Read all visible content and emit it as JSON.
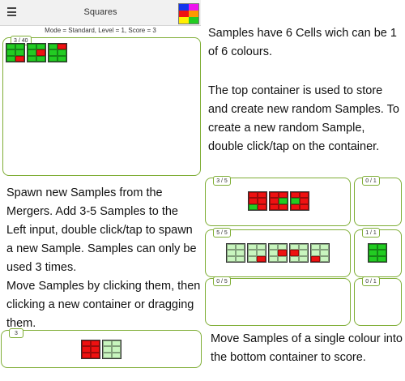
{
  "header": {
    "title": "Squares",
    "menu_icon": "hamburger-menu-icon"
  },
  "status_text": "Mode = Standard, Level = 1, Score = 3",
  "colors": {
    "green": "#22cc22",
    "light": "#c8f5be",
    "red": "#ee1111",
    "yellow": "#ffee00",
    "blue": "#1133ee",
    "magenta": "#ee11ee",
    "border": "#7fae36"
  },
  "logo_cells": [
    "#1133ee",
    "#ee11ee",
    "#ee1111",
    "#ff9900",
    "#ffee00",
    "#22cc22"
  ],
  "store": {
    "count": "3 / 40",
    "samples": [
      [
        "#22cc22",
        "#22cc22",
        "#22cc22",
        "#22cc22",
        "#22cc22",
        "#ee1111"
      ],
      [
        "#22cc22",
        "#22cc22",
        "#22cc22",
        "#ee1111",
        "#22cc22",
        "#22cc22"
      ],
      [
        "#22cc22",
        "#ee1111",
        "#22cc22",
        "#22cc22",
        "#22cc22",
        "#22cc22"
      ]
    ]
  },
  "merger1": {
    "left": {
      "count": "3 / 5",
      "samples": [
        [
          "#ee1111",
          "#ee1111",
          "#ee1111",
          "#ee1111",
          "#22cc22",
          "#ee1111"
        ],
        [
          "#ee1111",
          "#ee1111",
          "#ee1111",
          "#22cc22",
          "#ee1111",
          "#ee1111"
        ],
        [
          "#ee1111",
          "#ee1111",
          "#22cc22",
          "#ee1111",
          "#ee1111",
          "#ee1111"
        ]
      ]
    },
    "right": {
      "count": "0 / 1",
      "samples": []
    }
  },
  "merger2": {
    "left": {
      "count": "5 / 5",
      "samples": [
        [
          "#c8f5be",
          "#c8f5be",
          "#c8f5be",
          "#c8f5be",
          "#c8f5be",
          "#c8f5be"
        ],
        [
          "#c8f5be",
          "#c8f5be",
          "#c8f5be",
          "#c8f5be",
          "#c8f5be",
          "#ee1111"
        ],
        [
          "#c8f5be",
          "#c8f5be",
          "#c8f5be",
          "#ee1111",
          "#c8f5be",
          "#c8f5be"
        ],
        [
          "#c8f5be",
          "#c8f5be",
          "#ee1111",
          "#c8f5be",
          "#c8f5be",
          "#c8f5be"
        ],
        [
          "#c8f5be",
          "#c8f5be",
          "#c8f5be",
          "#c8f5be",
          "#ee1111",
          "#c8f5be"
        ]
      ]
    },
    "right": {
      "count": "1 / 1",
      "samples": [
        [
          "#22cc22",
          "#22cc22",
          "#22cc22",
          "#22cc22",
          "#22cc22",
          "#22cc22"
        ]
      ]
    }
  },
  "merger3": {
    "left": {
      "count": "0 / 5",
      "samples": []
    },
    "right": {
      "count": "0 / 1",
      "samples": []
    }
  },
  "score_box": {
    "count": "3",
    "samples": [
      [
        "#ee1111",
        "#ee1111",
        "#ee1111",
        "#ee1111",
        "#ee1111",
        "#ee1111"
      ],
      [
        "#c8f5be",
        "#c8f5be",
        "#c8f5be",
        "#c8f5be",
        "#c8f5be",
        "#c8f5be"
      ]
    ]
  },
  "instructions": {
    "samples": "Samples have 6 Cells wich can be 1 of 6 colours.",
    "top_container": "The top container is used to store and create new random Samples. To create a new random Sample, double click/tap on the container.",
    "spawn": "Spawn new Samples from the Mergers. Add 3-5 Samples to the Left input, double click/tap to spawn a new Sample. Samples can only be used 3 times.",
    "move": "Move Samples by clicking them, then clicking a new container or dragging them.",
    "score": "Move Samples of a single colour into the bottom container to score."
  }
}
